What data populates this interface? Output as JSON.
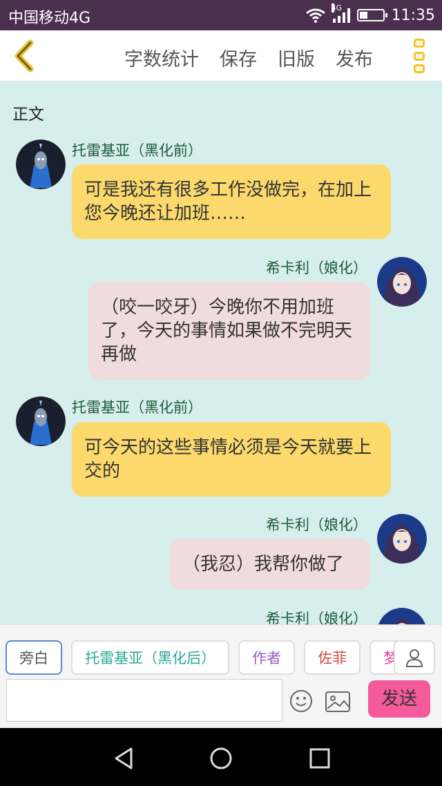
{
  "status_bar": {
    "carrier": "中国移动4G",
    "network": "4G",
    "time": "11:35",
    "battery_level": 0.35
  },
  "toolbar": {
    "back_icon": "chevron-left-icon",
    "actions": [
      "字数统计",
      "保存",
      "旧版",
      "发布"
    ],
    "more_icon": "more-icon"
  },
  "section_title": "正文",
  "messages": [
    {
      "speaker": "托雷基亚（黑化前）",
      "side": "left",
      "text": "可是我还有很多工作没做完，在加上您今晚还让加班……"
    },
    {
      "speaker": "希卡利（娘化）",
      "side": "right",
      "text": "（咬一咬牙）今晚你不用加班了，今天的事情如果做不完明天再做"
    },
    {
      "speaker": "托雷基亚（黑化前）",
      "side": "left",
      "text": "可今天的这些事情必须是今天就要上交的"
    },
    {
      "speaker": "希卡利（娘化）",
      "side": "right",
      "text": "（我忍）我帮你做了"
    },
    {
      "speaker": "希卡利（娘化）",
      "side": "right",
      "text": ""
    }
  ],
  "character_chips": [
    {
      "label": "旁白",
      "color": "#555555",
      "active": true
    },
    {
      "label": "托雷基亚（黑化后）",
      "color": "#2aa89a",
      "active": false
    },
    {
      "label": "作者",
      "color": "#9a5ac8",
      "active": false
    },
    {
      "label": "佐菲",
      "color": "#d24a3a",
      "active": false
    },
    {
      "label": "梦比",
      "color": "#e0409a",
      "active": false
    }
  ],
  "input": {
    "value": "",
    "placeholder": ""
  },
  "send_label": "发送",
  "colors": {
    "status_bar": "#4a2f4f",
    "chat_background": "#d6eeec",
    "left_bubble": "#fbd96c",
    "right_bubble": "#f0dcdc",
    "send_button": "#f55a9a",
    "accent_yellow": "#f1c232"
  }
}
